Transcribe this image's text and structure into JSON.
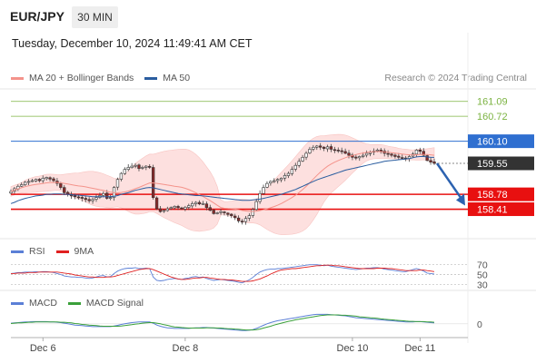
{
  "header": {
    "pair": "EUR/JPY",
    "timeframe": "30 MIN"
  },
  "datetime": "Tuesday, December 10, 2024 11:49:41 AM CET",
  "legend_main": [
    {
      "label": "MA 20 + Bollinger Bands",
      "color": "#f4938b"
    },
    {
      "label": "MA 50",
      "color": "#2a5d9f"
    }
  ],
  "credit": "Research © 2024 Trading Central",
  "legend_rsi": [
    {
      "label": "RSI",
      "color": "#5b7fd6"
    },
    {
      "label": "9MA",
      "color": "#e02020"
    }
  ],
  "legend_macd": [
    {
      "label": "MACD",
      "color": "#5b7fd6"
    },
    {
      "label": "MACD Signal",
      "color": "#3aa03a"
    }
  ],
  "colors": {
    "resistance_green": "#7cb342",
    "pivot_blue": "#2f6fd0",
    "support_red": "#e81010",
    "current_dark": "#333333",
    "arrow_blue": "#2c62b0",
    "band_fill": "#fde0df"
  },
  "chart_data": [
    {
      "type": "candlestick",
      "title": "EUR/JPY 30 MIN",
      "ylim": [
        157.7,
        161.4
      ],
      "x_ticks": [
        "Dec 6",
        "Dec 8",
        "Dec 10",
        "Dec 11"
      ],
      "levels": [
        {
          "label": "161.09",
          "value": 161.09,
          "kind": "resistance"
        },
        {
          "label": "160.72",
          "value": 160.72,
          "kind": "resistance"
        },
        {
          "label": "160.10",
          "value": 160.1,
          "kind": "pivot"
        },
        {
          "label": "159.55",
          "value": 159.55,
          "kind": "current"
        },
        {
          "label": "158.78",
          "value": 158.78,
          "kind": "support"
        },
        {
          "label": "158.41",
          "value": 158.41,
          "kind": "support"
        }
      ],
      "close": [
        158.85,
        158.92,
        158.98,
        159.02,
        159.08,
        159.1,
        159.12,
        159.15,
        159.12,
        159.18,
        159.2,
        159.16,
        159.12,
        159.05,
        158.95,
        158.82,
        158.78,
        158.74,
        158.72,
        158.7,
        158.68,
        158.65,
        158.62,
        158.65,
        158.7,
        158.75,
        158.8,
        158.68,
        158.7,
        158.95,
        159.15,
        159.3,
        159.4,
        159.45,
        159.48,
        159.5,
        159.42,
        159.45,
        159.48,
        159.45,
        158.7,
        158.42,
        158.35,
        158.38,
        158.42,
        158.45,
        158.48,
        158.45,
        158.42,
        158.46,
        158.5,
        158.55,
        158.58,
        158.54,
        158.55,
        158.45,
        158.38,
        158.3,
        158.32,
        158.35,
        158.32,
        158.28,
        158.25,
        158.2,
        158.12,
        158.1,
        158.18,
        158.25,
        158.4,
        158.6,
        158.8,
        158.95,
        159.05,
        159.1,
        159.12,
        159.15,
        159.18,
        159.25,
        159.3,
        159.4,
        159.5,
        159.6,
        159.7,
        159.8,
        159.9,
        159.95,
        159.98,
        159.95,
        159.92,
        159.96,
        159.9,
        159.88,
        159.86,
        159.84,
        159.8,
        159.75,
        159.7,
        159.68,
        159.72,
        159.75,
        159.8,
        159.82,
        159.85,
        159.88,
        159.85,
        159.8,
        159.78,
        159.75,
        159.72,
        159.7,
        159.68,
        159.66,
        159.72,
        159.78,
        159.88,
        159.85,
        159.75,
        159.62,
        159.58,
        159.55
      ],
      "ma50": [
        158.55,
        158.58,
        158.62,
        158.65,
        158.68,
        158.7,
        158.72,
        158.74,
        158.75,
        158.76,
        158.78,
        158.78,
        158.79,
        158.79,
        158.79,
        158.78,
        158.78,
        158.77,
        158.76,
        158.76,
        158.75,
        158.74,
        158.73,
        158.72,
        158.72,
        158.72,
        158.72,
        158.72,
        158.72,
        158.73,
        158.75,
        158.78,
        158.8,
        158.82,
        158.85,
        158.88,
        158.9,
        158.92,
        158.94,
        158.95,
        158.94,
        158.92,
        158.9,
        158.88,
        158.86,
        158.84,
        158.82,
        158.8,
        158.79,
        158.78,
        158.77,
        158.76,
        158.75,
        158.75,
        158.74,
        158.73,
        158.72,
        158.71,
        158.7,
        158.69,
        158.68,
        158.67,
        158.66,
        158.65,
        158.64,
        158.63,
        158.63,
        158.63,
        158.64,
        158.65,
        158.66,
        158.68,
        158.7,
        158.72,
        158.74,
        158.76,
        158.78,
        158.81,
        158.84,
        158.87,
        158.9,
        158.94,
        158.98,
        159.02,
        159.06,
        159.1,
        159.14,
        159.17,
        159.2,
        159.23,
        159.26,
        159.29,
        159.32,
        159.35,
        159.38,
        159.4,
        159.42,
        159.44,
        159.46,
        159.48,
        159.5,
        159.52,
        159.54,
        159.56,
        159.58,
        159.6,
        159.61,
        159.62,
        159.63,
        159.64,
        159.65,
        159.66,
        159.67,
        159.69,
        159.71,
        159.72,
        159.72,
        159.71,
        159.7,
        159.7
      ]
    },
    {
      "type": "line",
      "title": "RSI",
      "ylim": [
        25,
        75
      ],
      "y_ticks": [
        "70",
        "50",
        "30"
      ],
      "series": [
        {
          "name": "RSI",
          "values": [
            52,
            53,
            54,
            54,
            55,
            55,
            55,
            56,
            55,
            56,
            56,
            55,
            54,
            52,
            50,
            47,
            46,
            45,
            45,
            44,
            44,
            43,
            42,
            43,
            45,
            47,
            48,
            45,
            46,
            52,
            57,
            60,
            62,
            63,
            63,
            64,
            62,
            62,
            63,
            62,
            45,
            38,
            37,
            38,
            40,
            41,
            42,
            41,
            40,
            42,
            43,
            45,
            46,
            44,
            45,
            42,
            40,
            38,
            39,
            40,
            39,
            38,
            37,
            36,
            34,
            33,
            36,
            39,
            44,
            50,
            55,
            58,
            60,
            61,
            61,
            62,
            62,
            63,
            64,
            65,
            66,
            67,
            68,
            69,
            70,
            70,
            70,
            69,
            68,
            69,
            67,
            66,
            65,
            64,
            63,
            62,
            61,
            60,
            61,
            62,
            63,
            63,
            64,
            64,
            63,
            61,
            60,
            59,
            58,
            57,
            56,
            56,
            58,
            60,
            62,
            60,
            57,
            53,
            52,
            51
          ]
        },
        {
          "name": "9MA",
          "values": [
            52,
            52,
            53,
            53,
            53,
            54,
            54,
            54,
            55,
            55,
            55,
            55,
            55,
            55,
            54,
            53,
            52,
            51,
            49,
            48,
            47,
            46,
            45,
            45,
            44,
            44,
            44,
            45,
            45,
            46,
            48,
            50,
            52,
            54,
            56,
            58,
            60,
            61,
            62,
            62,
            60,
            57,
            54,
            51,
            48,
            45,
            43,
            41,
            40,
            40,
            41,
            42,
            43,
            43,
            44,
            44,
            43,
            42,
            41,
            40,
            40,
            39,
            39,
            38,
            37,
            36,
            36,
            36,
            37,
            39,
            41,
            44,
            47,
            51,
            54,
            57,
            59,
            60,
            61,
            62,
            62,
            63,
            64,
            65,
            66,
            67,
            68,
            68,
            69,
            69,
            69,
            68,
            68,
            67,
            66,
            65,
            64,
            63,
            62,
            62,
            62,
            62,
            62,
            63,
            63,
            63,
            62,
            62,
            61,
            60,
            59,
            58,
            58,
            58,
            58,
            59,
            59,
            58,
            57,
            56
          ]
        }
      ]
    },
    {
      "type": "line",
      "title": "MACD",
      "ylim": [
        -0.45,
        0.35
      ],
      "y_ticks": [
        "0"
      ],
      "series": [
        {
          "name": "MACD",
          "values": [
            0.02,
            0.03,
            0.04,
            0.05,
            0.06,
            0.06,
            0.07,
            0.07,
            0.07,
            0.07,
            0.07,
            0.06,
            0.06,
            0.05,
            0.04,
            0.02,
            0.0,
            -0.02,
            -0.04,
            -0.05,
            -0.06,
            -0.07,
            -0.08,
            -0.09,
            -0.09,
            -0.09,
            -0.09,
            -0.09,
            -0.09,
            -0.07,
            -0.05,
            -0.02,
            0.0,
            0.02,
            0.04,
            0.05,
            0.06,
            0.06,
            0.06,
            0.06,
            0.02,
            -0.04,
            -0.08,
            -0.11,
            -0.13,
            -0.14,
            -0.15,
            -0.15,
            -0.15,
            -0.15,
            -0.15,
            -0.14,
            -0.13,
            -0.13,
            -0.12,
            -0.12,
            -0.13,
            -0.14,
            -0.15,
            -0.16,
            -0.17,
            -0.18,
            -0.19,
            -0.2,
            -0.21,
            -0.22,
            -0.22,
            -0.21,
            -0.19,
            -0.15,
            -0.1,
            -0.05,
            0.0,
            0.04,
            0.07,
            0.1,
            0.12,
            0.14,
            0.16,
            0.18,
            0.2,
            0.22,
            0.24,
            0.26,
            0.28,
            0.3,
            0.31,
            0.31,
            0.31,
            0.31,
            0.3,
            0.29,
            0.28,
            0.27,
            0.26,
            0.24,
            0.22,
            0.2,
            0.19,
            0.18,
            0.17,
            0.16,
            0.15,
            0.14,
            0.13,
            0.12,
            0.11,
            0.1,
            0.09,
            0.08,
            0.07,
            0.06,
            0.06,
            0.06,
            0.07,
            0.07,
            0.06,
            0.05,
            0.04,
            0.03
          ]
        },
        {
          "name": "MACD Signal",
          "values": [
            0.01,
            0.02,
            0.03,
            0.03,
            0.04,
            0.05,
            0.05,
            0.06,
            0.06,
            0.06,
            0.06,
            0.06,
            0.06,
            0.06,
            0.05,
            0.05,
            0.04,
            0.03,
            0.01,
            0.0,
            -0.02,
            -0.03,
            -0.04,
            -0.05,
            -0.06,
            -0.07,
            -0.08,
            -0.08,
            -0.08,
            -0.08,
            -0.08,
            -0.07,
            -0.06,
            -0.04,
            -0.03,
            -0.01,
            0.0,
            0.02,
            0.03,
            0.04,
            0.04,
            0.02,
            0.0,
            -0.03,
            -0.05,
            -0.08,
            -0.1,
            -0.11,
            -0.12,
            -0.13,
            -0.14,
            -0.14,
            -0.14,
            -0.14,
            -0.14,
            -0.13,
            -0.13,
            -0.13,
            -0.14,
            -0.14,
            -0.15,
            -0.16,
            -0.16,
            -0.17,
            -0.18,
            -0.19,
            -0.2,
            -0.2,
            -0.2,
            -0.19,
            -0.17,
            -0.14,
            -0.11,
            -0.08,
            -0.04,
            -0.01,
            0.02,
            0.05,
            0.08,
            0.1,
            0.13,
            0.15,
            0.17,
            0.19,
            0.21,
            0.23,
            0.25,
            0.27,
            0.28,
            0.29,
            0.29,
            0.29,
            0.29,
            0.28,
            0.28,
            0.27,
            0.26,
            0.25,
            0.23,
            0.22,
            0.21,
            0.2,
            0.19,
            0.18,
            0.16,
            0.15,
            0.14,
            0.13,
            0.12,
            0.11,
            0.1,
            0.09,
            0.08,
            0.08,
            0.07,
            0.07,
            0.07,
            0.06,
            0.06,
            0.05
          ]
        }
      ]
    }
  ]
}
